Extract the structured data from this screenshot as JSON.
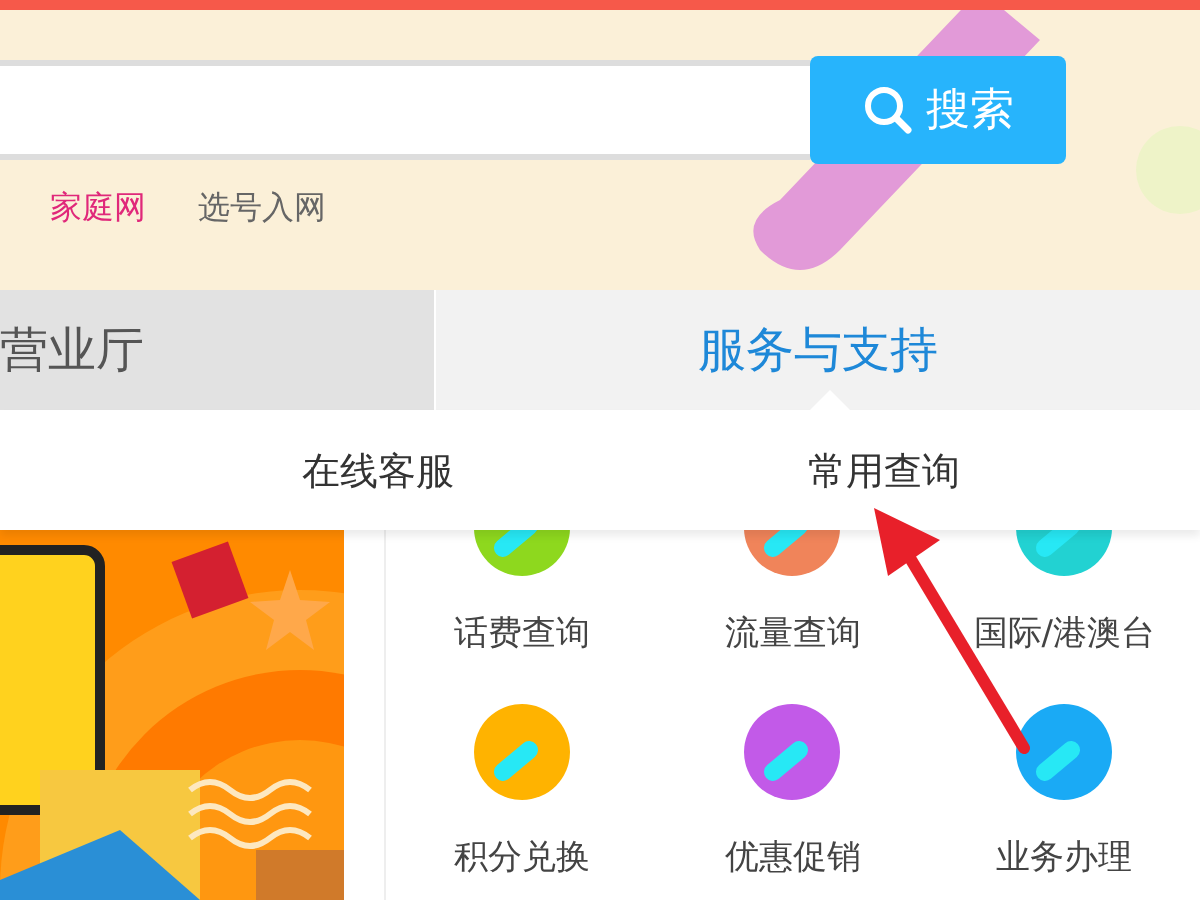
{
  "search": {
    "button": "搜索"
  },
  "links": [
    {
      "label": "家庭网",
      "highlighted": true
    },
    {
      "label": "选号入网",
      "highlighted": false
    }
  ],
  "tabs": [
    {
      "label": "营业厅",
      "selected": false
    },
    {
      "label": "服务与支持",
      "selected": true
    }
  ],
  "submenu": [
    {
      "label": "在线客服"
    },
    {
      "label": "常用查询"
    }
  ],
  "services": [
    {
      "label": "话费查询",
      "color": "#8ed81e"
    },
    {
      "label": "流量查询",
      "color": "#f0845a"
    },
    {
      "label": "国际/港澳台",
      "color": "#22d2d2"
    },
    {
      "label": "积分兑换",
      "color": "#ffb300"
    },
    {
      "label": "优惠促销",
      "color": "#c25ae8"
    },
    {
      "label": "业务办理",
      "color": "#1aaaf5"
    }
  ]
}
